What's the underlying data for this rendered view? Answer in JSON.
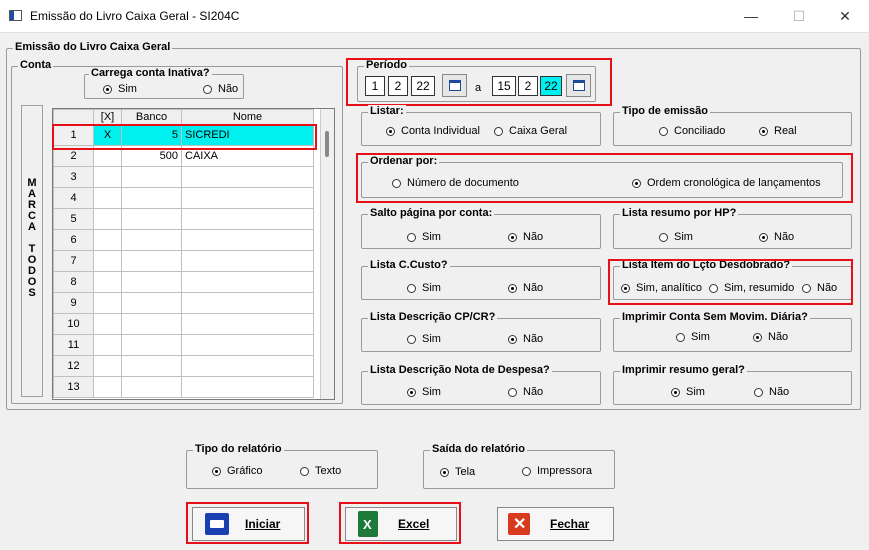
{
  "window": {
    "title": "Emissão do Livro Caixa Geral - SI204C",
    "minimize": "—",
    "maximize": "☐",
    "close": "✕"
  },
  "main_group": "Emissão do Livro Caixa Geral",
  "conta": {
    "label": "Conta",
    "carrega_label": "Carrega conta Inativa?",
    "sim": "Sim",
    "nao": "Não",
    "marca_todos": [
      "M",
      "A",
      "R",
      "C",
      "A",
      "",
      "T",
      "O",
      "D",
      "O",
      "S"
    ],
    "headers": [
      "[X]",
      "Banco",
      "Nome"
    ],
    "rows": [
      {
        "n": "1",
        "x": "X",
        "banco": "5",
        "nome": "SICREDI"
      },
      {
        "n": "2",
        "x": "",
        "banco": "500",
        "nome": "CAIXA"
      },
      {
        "n": "3",
        "x": "",
        "banco": "",
        "nome": ""
      },
      {
        "n": "4",
        "x": "",
        "banco": "",
        "nome": ""
      },
      {
        "n": "5",
        "x": "",
        "banco": "",
        "nome": ""
      },
      {
        "n": "6",
        "x": "",
        "banco": "",
        "nome": ""
      },
      {
        "n": "7",
        "x": "",
        "banco": "",
        "nome": ""
      },
      {
        "n": "8",
        "x": "",
        "banco": "",
        "nome": ""
      },
      {
        "n": "9",
        "x": "",
        "banco": "",
        "nome": ""
      },
      {
        "n": "10",
        "x": "",
        "banco": "",
        "nome": ""
      },
      {
        "n": "11",
        "x": "",
        "banco": "",
        "nome": ""
      },
      {
        "n": "12",
        "x": "",
        "banco": "",
        "nome": ""
      },
      {
        "n": "13",
        "x": "",
        "banco": "",
        "nome": ""
      }
    ]
  },
  "periodo": {
    "label": "Período",
    "d1": "1",
    "m1": "2",
    "y1": "22",
    "a": "a",
    "d2": "15",
    "m2": "2",
    "y2": "22"
  },
  "listar": {
    "label": "Listar:",
    "opt1": "Conta Individual",
    "opt2": "Caixa Geral"
  },
  "tipo_emissao": {
    "label": "Tipo de emissão",
    "opt1": "Conciliado",
    "opt2": "Real"
  },
  "ordenar": {
    "label": "Ordenar por:",
    "opt1": "Número de documento",
    "opt2": "Ordem cronológica de lançamentos"
  },
  "salto": {
    "label": "Salto página por conta:",
    "sim": "Sim",
    "nao": "Não"
  },
  "resumo_hp": {
    "label": "Lista resumo por HP?",
    "sim": "Sim",
    "nao": "Não"
  },
  "ccusto": {
    "label": "Lista C.Custo?",
    "sim": "Sim",
    "nao": "Não"
  },
  "item_desdobrado": {
    "label": "Lista Item do Lçto Desdobrado?",
    "opt1": "Sim, analítico",
    "opt2": "Sim, resumido",
    "opt3": "Não"
  },
  "descricao_cpcr": {
    "label": "Lista Descrição CP/CR?",
    "sim": "Sim",
    "nao": "Não"
  },
  "conta_sem_mov": {
    "label": "Imprimir Conta Sem Movim. Diária?",
    "sim": "Sim",
    "nao": "Não"
  },
  "nota_despesa": {
    "label": "Lista Descrição Nota de Despesa?",
    "sim": "Sim",
    "nao": "Não"
  },
  "resumo_geral": {
    "label": "Imprimir resumo geral?",
    "sim": "Sim",
    "nao": "Não"
  },
  "tipo_relatorio": {
    "label": "Tipo do relatório",
    "opt1": "Gráfico",
    "opt2": "Texto"
  },
  "saida_relatorio": {
    "label": "Saída do relatório",
    "opt1": "Tela",
    "opt2": "Impressora"
  },
  "buttons": {
    "iniciar": "Iniciar",
    "excel": "Excel",
    "fechar": "Fechar"
  },
  "colors": {
    "highlight": "#00f0f0",
    "red_frame": "#e81018"
  }
}
